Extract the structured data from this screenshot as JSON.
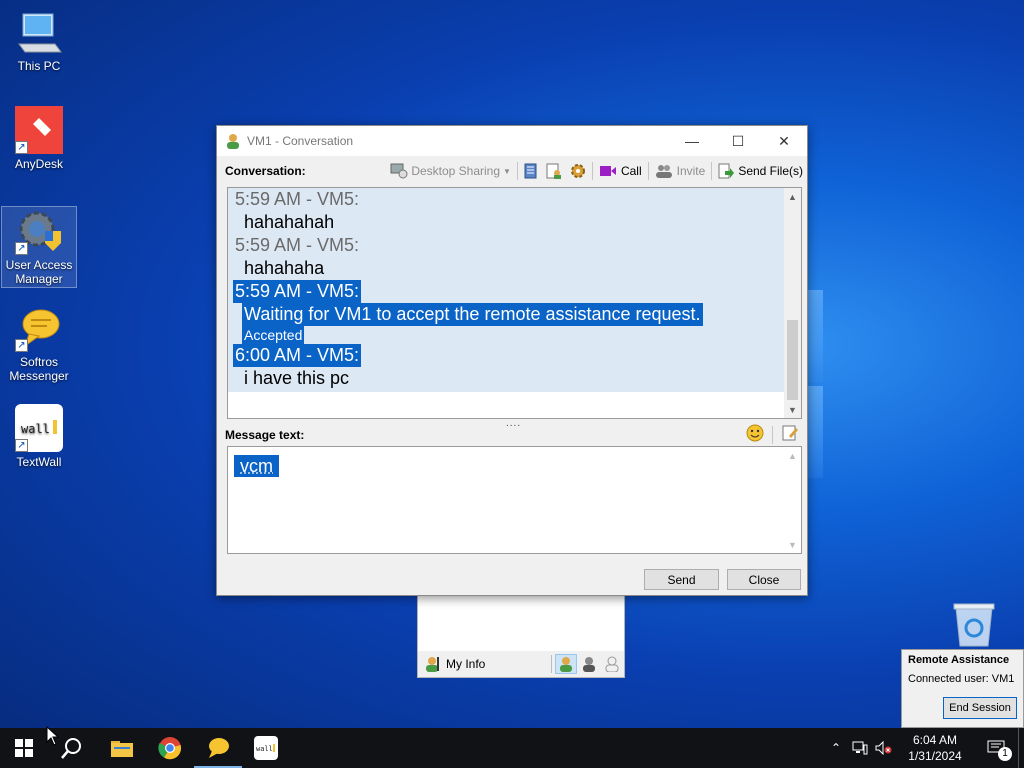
{
  "desktop": {
    "icons": [
      {
        "label": "This PC"
      },
      {
        "label": "AnyDesk"
      },
      {
        "label": "User Access Manager"
      },
      {
        "label": "Softros Messenger"
      },
      {
        "label": "TextWall"
      }
    ],
    "recycle_bin_icon": "recycle-bin-icon"
  },
  "conversation": {
    "title": "VM1 - Conversation",
    "label": "Conversation:",
    "toolbar": {
      "desktop_sharing": "Desktop Sharing",
      "call": "Call",
      "invite": "Invite",
      "send_files": "Send File(s)"
    },
    "messages": [
      {
        "header": "5:59 AM - VM5:",
        "text": "hahahahah",
        "selected": false
      },
      {
        "header": "5:59 AM - VM5:",
        "text": "hahahaha",
        "selected": false
      },
      {
        "header": "5:59 AM - VM5:",
        "text": "Waiting for VM1 to accept the remote assistance request.",
        "note": "Accepted",
        "selected": true
      },
      {
        "header": "6:00 AM - VM5:",
        "text": "i have this pc",
        "selected": true
      }
    ],
    "message_label": "Message text:",
    "message_value": "vcm",
    "send_button": "Send",
    "close_button": "Close"
  },
  "contact_list": {
    "my_info": "My Info"
  },
  "remote_assistance": {
    "title": "Remote Assistance",
    "connected": "Connected user: VM1",
    "end_button": "End Session"
  },
  "taskbar": {
    "time": "6:04 AM",
    "date": "1/31/2024",
    "notification_count": "1"
  },
  "colors": {
    "accent": "#0a64c8",
    "taskbar": "#101216"
  }
}
